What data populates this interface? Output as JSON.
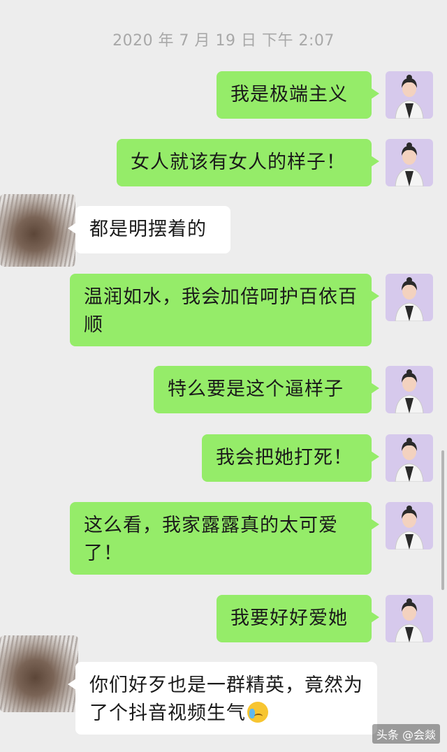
{
  "timestamp": "2020 年 7 月 19 日 下午 2:07",
  "messages": [
    {
      "side": "out",
      "text": "我是极端主义"
    },
    {
      "side": "out",
      "text": "女人就该有女人的样子！"
    },
    {
      "side": "in",
      "text": "都是明摆着的"
    },
    {
      "side": "out",
      "text": "温润如水，我会加倍呵护百依百顺"
    },
    {
      "side": "out",
      "text": "特么要是这个逼样子"
    },
    {
      "side": "out",
      "text": "我会把她打死！"
    },
    {
      "side": "out",
      "text": "这么看，我家露露真的太可爱了！"
    },
    {
      "side": "out",
      "text": "我要好好爱她"
    },
    {
      "side": "in",
      "text": "你们好歹也是一群精英，竟然为了个抖音视频生气",
      "emoji": "crying-face-icon"
    }
  ],
  "watermark": "头条 @会燚",
  "colors": {
    "background": "#ededed",
    "outgoing_bubble": "#95ec69",
    "incoming_bubble": "#ffffff",
    "my_avatar_bg": "#d6c9ec"
  }
}
